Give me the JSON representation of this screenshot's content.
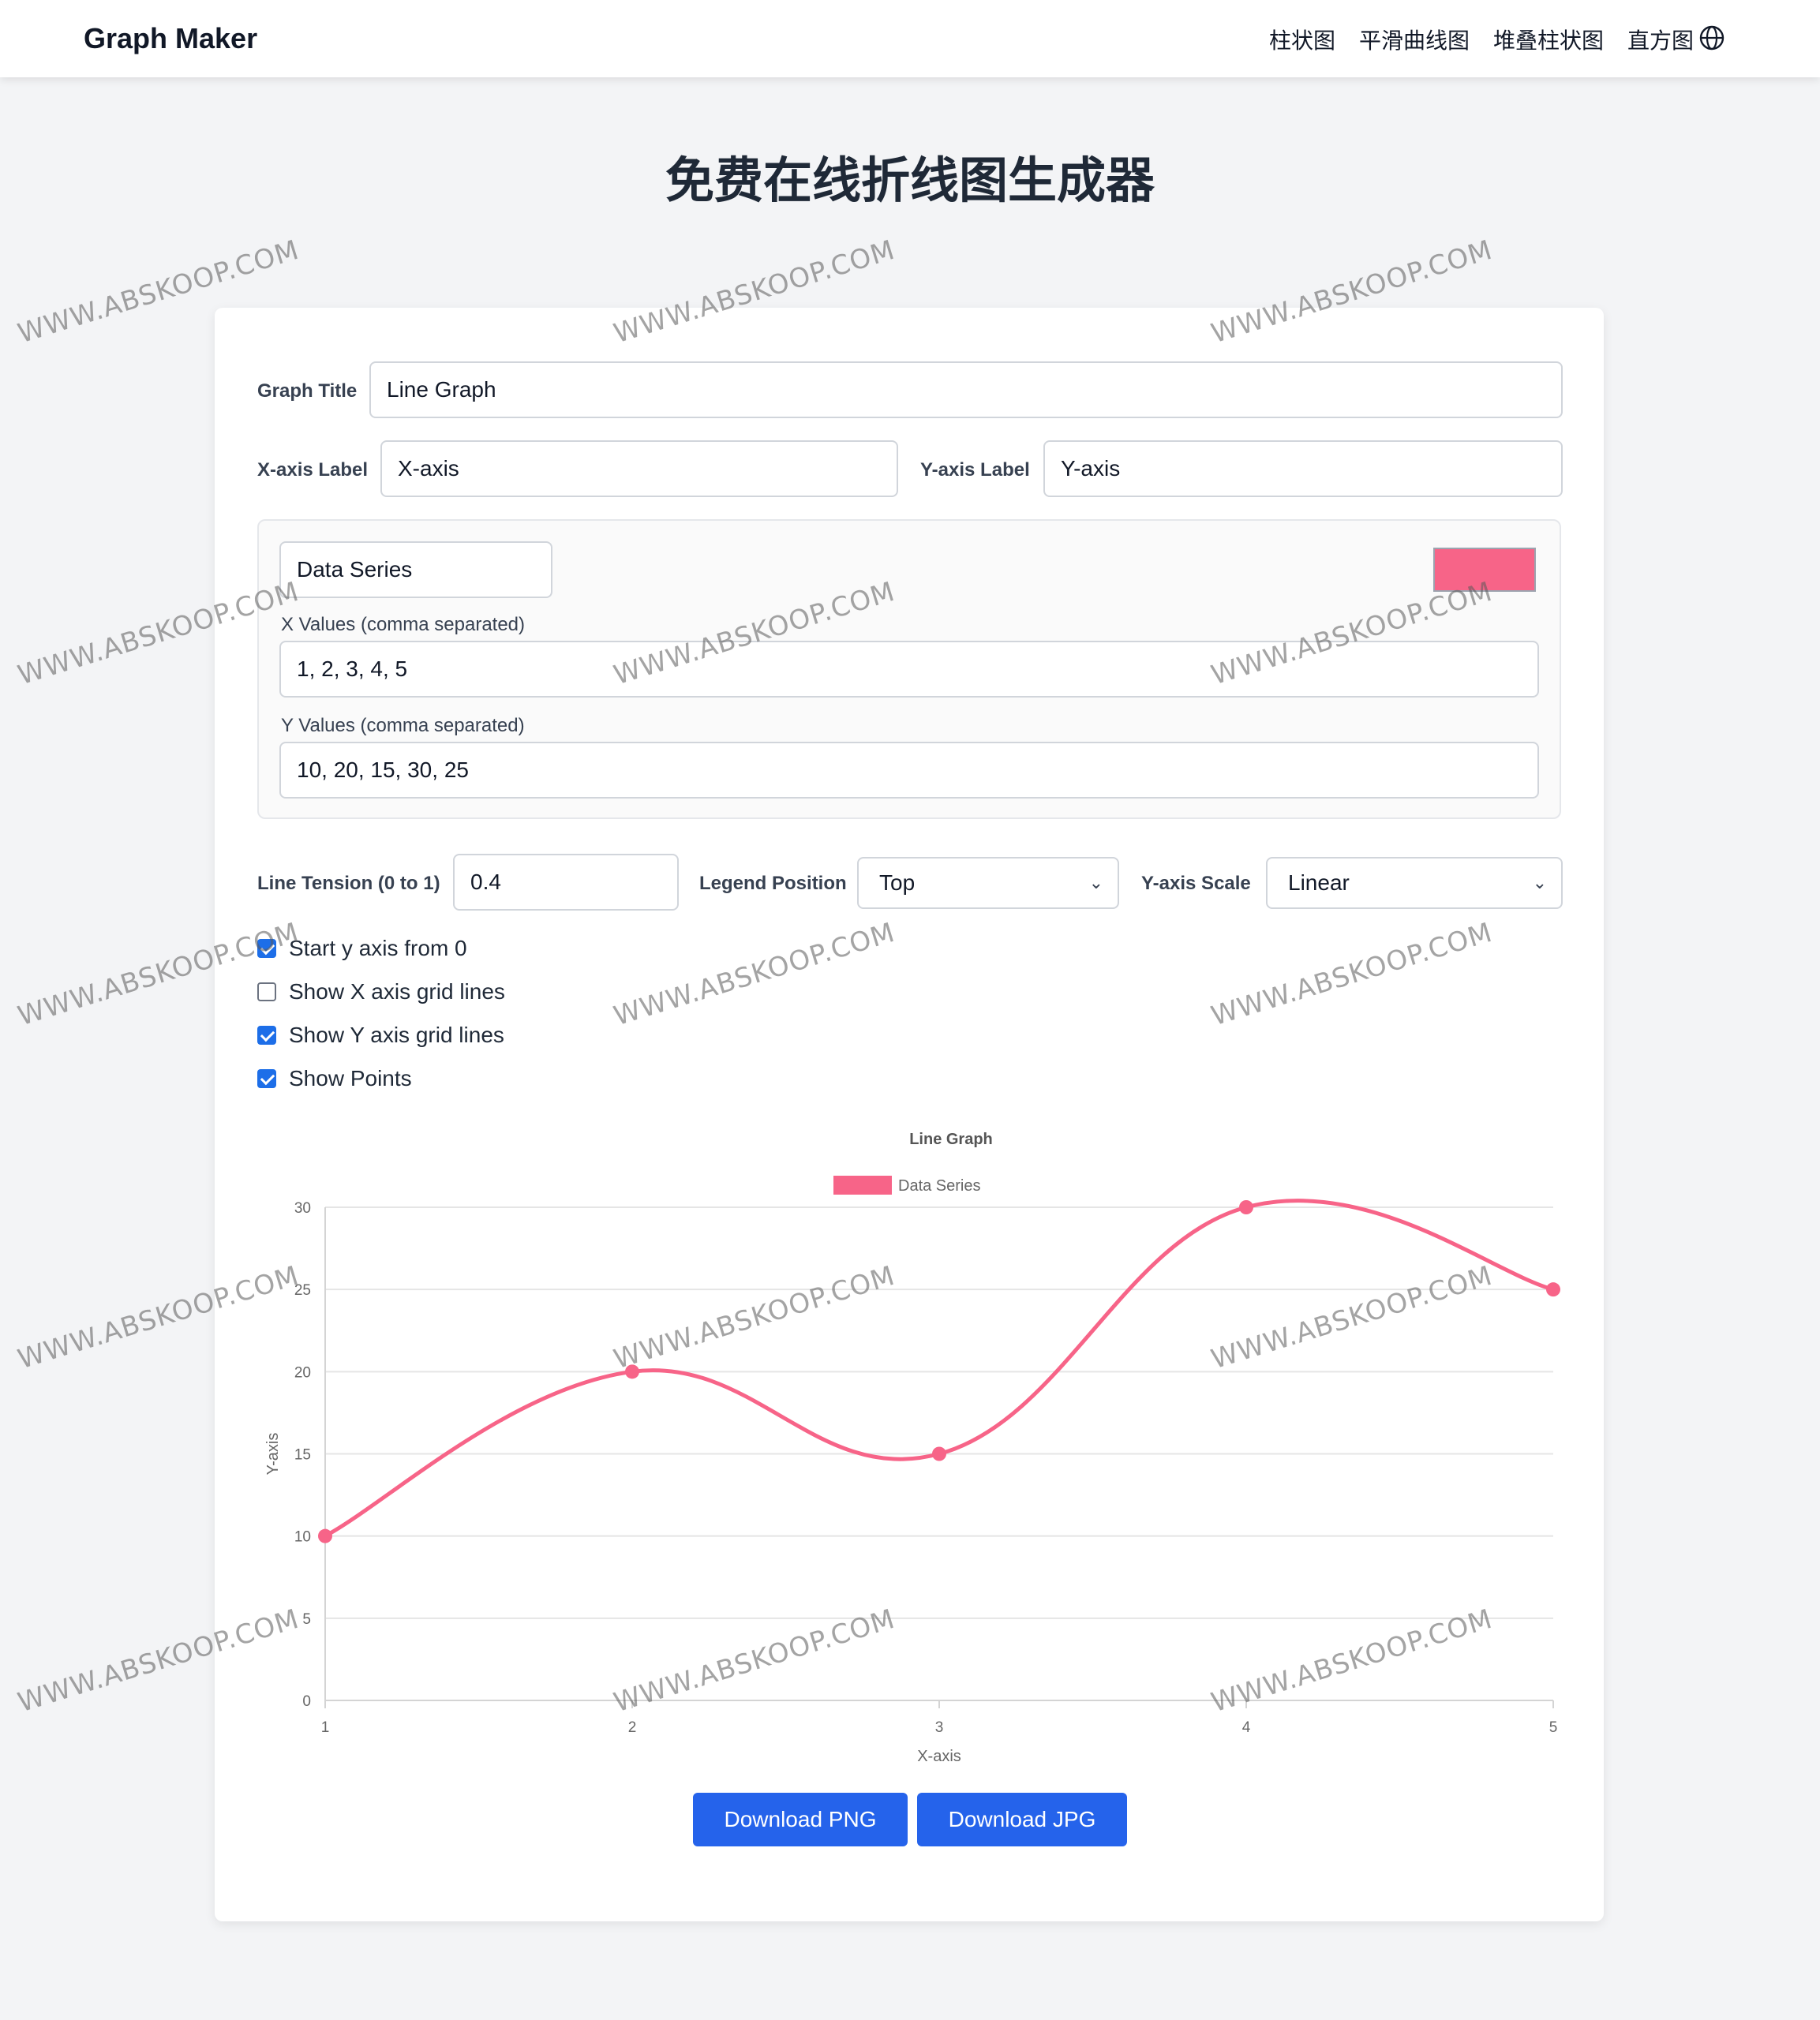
{
  "header": {
    "brand": "Graph Maker",
    "nav_links": [
      "柱状图",
      "平滑曲线图",
      "堆叠柱状图",
      "直方图"
    ],
    "language_icon": "globe-icon"
  },
  "page": {
    "title": "免费在线折线图生成器"
  },
  "form": {
    "graph_title_label": "Graph Title",
    "graph_title_value": "Line Graph",
    "x_axis_label_label": "X-axis Label",
    "x_axis_label_value": "X-axis",
    "y_axis_label_label": "Y-axis Label",
    "y_axis_label_value": "Y-axis",
    "series": {
      "name_value": "Data Series",
      "color": "#f76488",
      "x_values_label": "X Values (comma separated)",
      "x_values_value": "1, 2, 3, 4, 5",
      "y_values_label": "Y Values (comma separated)",
      "y_values_value": "10, 20, 15, 30, 25"
    },
    "line_tension_label": "Line Tension (0 to 1)",
    "line_tension_value": "0.4",
    "legend_position_label": "Legend Position",
    "legend_position_value": "Top",
    "y_scale_label": "Y-axis Scale",
    "y_scale_value": "Linear",
    "checkboxes": [
      {
        "label": "Start y axis from 0",
        "checked": true
      },
      {
        "label": "Show X axis grid lines",
        "checked": false
      },
      {
        "label": "Show Y axis grid lines",
        "checked": true
      },
      {
        "label": "Show Points",
        "checked": true
      }
    ]
  },
  "chart_data": {
    "type": "line",
    "title": "Line Graph",
    "xlabel": "X-axis",
    "ylabel": "Y-axis",
    "x": [
      1,
      2,
      3,
      4,
      5
    ],
    "series": [
      {
        "name": "Data Series",
        "values": [
          10,
          20,
          15,
          30,
          25
        ],
        "color": "#f76488"
      }
    ],
    "ylim": [
      0,
      30
    ],
    "y_ticks": [
      0,
      5,
      10,
      15,
      20,
      25,
      30
    ],
    "x_ticks": [
      1,
      2,
      3,
      4,
      5
    ],
    "legend_position": "top",
    "x_grid": false,
    "y_grid": true,
    "smooth": true,
    "show_points": true
  },
  "buttons": {
    "download_png": "Download PNG",
    "download_jpg": "Download JPG"
  },
  "watermark": "WWW.ABSKOOP.COM"
}
